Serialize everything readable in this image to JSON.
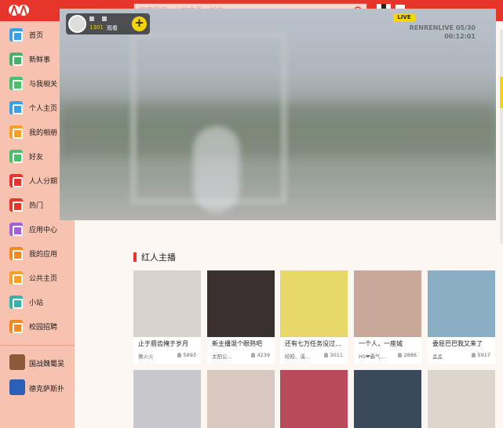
{
  "search": {
    "placeholder": "搜索昵称、公共主页、好友"
  },
  "sidebar": {
    "items": [
      {
        "label": "首页",
        "color": "#3aa0e8",
        "icon": "home-icon"
      },
      {
        "label": "新鲜事",
        "color": "#47b36a",
        "icon": "news-icon"
      },
      {
        "label": "与我相关",
        "color": "#4bbf6b",
        "icon": "related-icon"
      },
      {
        "label": "个人主页",
        "color": "#3aa0e8",
        "icon": "profile-icon"
      },
      {
        "label": "我的相册",
        "color": "#f2a22c",
        "icon": "album-icon"
      },
      {
        "label": "好友",
        "color": "#4bbf6b",
        "icon": "friends-icon"
      },
      {
        "label": "人人分期",
        "color": "#e6362c",
        "icon": "installment-icon"
      },
      {
        "label": "热门",
        "color": "#e6362c",
        "icon": "hot-icon"
      },
      {
        "label": "应用中心",
        "color": "#a063d6",
        "icon": "app-center-icon"
      },
      {
        "label": "我的应用",
        "color": "#f08a24",
        "icon": "my-apps-icon"
      },
      {
        "label": "公共主页",
        "color": "#f2a22c",
        "icon": "public-page-icon"
      },
      {
        "label": "小站",
        "color": "#36b3a8",
        "icon": "station-icon"
      },
      {
        "label": "校园招聘",
        "color": "#f08a24",
        "icon": "campus-hiring-icon"
      }
    ],
    "games": [
      {
        "label": "国战魏蜀吴",
        "color": "#8a5a3a",
        "icon": "game-guozhan-icon"
      },
      {
        "label": "德克萨斯扑",
        "color": "#2b5fb8",
        "icon": "game-texas-icon"
      }
    ]
  },
  "live": {
    "host_count": "1301",
    "watch_label": "观看",
    "badge": "LIVE",
    "brand": "RENRENLIVE 05/30",
    "time": "00:12:01"
  },
  "section": {
    "title": "红人主播"
  },
  "cards": [
    {
      "caption": "止于唇齿掩于岁月",
      "nick": "黄火火",
      "viewers": "5893",
      "color": "#d9d3cf"
    },
    {
      "caption": "新主播混个眼熟吧",
      "nick": "太阳公...",
      "viewers": "4239",
      "color": "#3a3030"
    },
    {
      "caption": "还有七万任务没过...",
      "nick": "皎皎、溪...",
      "viewers": "3011",
      "color": "#e8d86a"
    },
    {
      "caption": "一个人，一座城",
      "nick": "HS❤霸气...",
      "viewers": "2886",
      "color": "#c9a89a"
    },
    {
      "caption": "委屈巴巴我又来了",
      "nick": "孟孟",
      "viewers": "5917",
      "color": "#8aaec4"
    }
  ],
  "bottom_cards": [
    {
      "color": "#c7c7cc"
    },
    {
      "color": "#d8c8c0"
    },
    {
      "color": "#b84a5a"
    },
    {
      "color": "#3a4a5a"
    },
    {
      "color": "#dcd6cc"
    }
  ]
}
